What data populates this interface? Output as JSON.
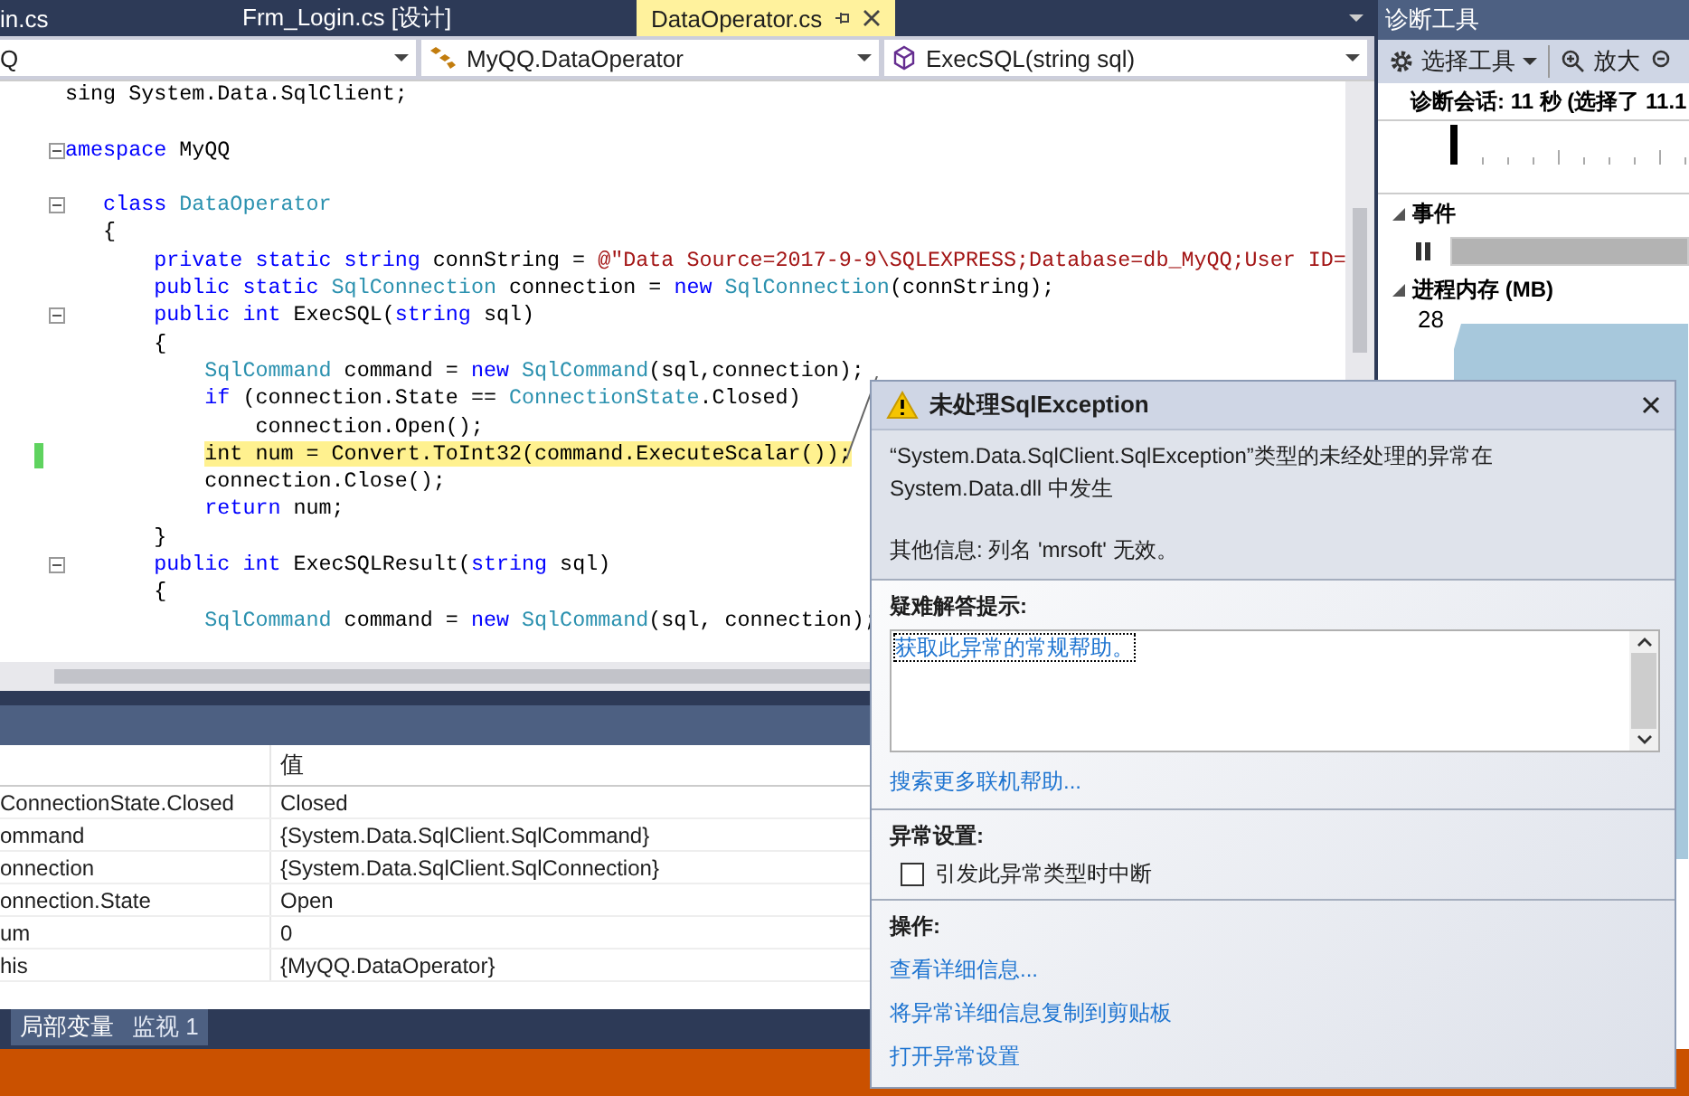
{
  "tabs": [
    {
      "label": "in.cs",
      "selected": false
    },
    {
      "label": "Frm_Login.cs [设计]",
      "selected": false
    },
    {
      "label": "DataOperator.cs",
      "selected": true
    }
  ],
  "nav": [
    {
      "kind": "project",
      "text": "Q"
    },
    {
      "kind": "class",
      "text": "MyQQ.DataOperator"
    },
    {
      "kind": "method",
      "text": "ExecSQL(string sql)"
    }
  ],
  "code": {
    "lines": [
      {
        "fold": false,
        "current": false,
        "segments": [
          {
            "kind": "plain",
            "text": "sing System.Data.SqlClient;"
          }
        ]
      },
      {
        "fold": false,
        "current": false
      },
      {
        "fold": true,
        "current": false,
        "segments": [
          {
            "kind": "kw",
            "text": "amespace"
          },
          {
            "kind": "plain",
            "text": " MyQQ"
          }
        ]
      },
      {
        "fold": false,
        "current": false
      },
      {
        "fold": true,
        "current": false,
        "segments": [
          {
            "kind": "kw",
            "text": "   class "
          },
          {
            "kind": "type",
            "text": "DataOperator"
          }
        ]
      },
      {
        "fold": false,
        "current": false,
        "segments": [
          {
            "kind": "plain",
            "text": "   {"
          }
        ]
      },
      {
        "fold": false,
        "current": false,
        "segments": [
          {
            "kind": "kw",
            "text": "       private static string"
          },
          {
            "kind": "plain",
            "text": " connString = "
          },
          {
            "kind": "str",
            "text": "@\"Data Source=2017-9-9\\SQLEXPRESS;Database=db_MyQQ;User ID="
          }
        ]
      },
      {
        "fold": false,
        "current": false,
        "segments": [
          {
            "kind": "kw",
            "text": "       public static "
          },
          {
            "kind": "type",
            "text": "SqlConnection"
          },
          {
            "kind": "plain",
            "text": " connection = "
          },
          {
            "kind": "kw",
            "text": "new "
          },
          {
            "kind": "type",
            "text": "SqlConnection"
          },
          {
            "kind": "plain",
            "text": "(connString);"
          }
        ]
      },
      {
        "fold": true,
        "current": false,
        "segments": [
          {
            "kind": "kw",
            "text": "       public int"
          },
          {
            "kind": "plain",
            "text": " ExecSQL("
          },
          {
            "kind": "kw",
            "text": "string"
          },
          {
            "kind": "plain",
            "text": " sql)"
          }
        ]
      },
      {
        "fold": false,
        "current": false,
        "segments": [
          {
            "kind": "plain",
            "text": "       {"
          }
        ]
      },
      {
        "fold": false,
        "current": false,
        "segments": [
          {
            "kind": "type",
            "text": "           SqlCommand"
          },
          {
            "kind": "plain",
            "text": " command = "
          },
          {
            "kind": "kw",
            "text": "new "
          },
          {
            "kind": "type",
            "text": "SqlCommand"
          },
          {
            "kind": "plain",
            "text": "(sql,connection);"
          }
        ]
      },
      {
        "fold": false,
        "current": false,
        "segments": [
          {
            "kind": "kw",
            "text": "           if"
          },
          {
            "kind": "plain",
            "text": " (connection.State == "
          },
          {
            "kind": "type",
            "text": "ConnectionState"
          },
          {
            "kind": "plain",
            "text": ".Closed)"
          }
        ]
      },
      {
        "fold": false,
        "current": false,
        "segments": [
          {
            "kind": "plain",
            "text": "               connection.Open();"
          }
        ]
      },
      {
        "fold": false,
        "current": true,
        "segments": [
          {
            "kind": "plain",
            "text": "           int num = Convert.ToInt32(command.ExecuteScalar());"
          }
        ]
      },
      {
        "fold": false,
        "current": false,
        "segments": [
          {
            "kind": "plain",
            "text": "           connection.Close();"
          }
        ]
      },
      {
        "fold": false,
        "current": false,
        "segments": [
          {
            "kind": "kw",
            "text": "           return"
          },
          {
            "kind": "plain",
            "text": " num;"
          }
        ]
      },
      {
        "fold": false,
        "current": false,
        "segments": [
          {
            "kind": "plain",
            "text": "       }"
          }
        ]
      },
      {
        "fold": true,
        "current": false,
        "segments": [
          {
            "kind": "kw",
            "text": "       public int"
          },
          {
            "kind": "plain",
            "text": " ExecSQLResult("
          },
          {
            "kind": "kw",
            "text": "string"
          },
          {
            "kind": "plain",
            "text": " sql)"
          }
        ]
      },
      {
        "fold": false,
        "current": false,
        "segments": [
          {
            "kind": "plain",
            "text": "       {"
          }
        ]
      },
      {
        "fold": false,
        "current": false,
        "segments": [
          {
            "kind": "type",
            "text": "           SqlCommand"
          },
          {
            "kind": "plain",
            "text": " command = "
          },
          {
            "kind": "kw",
            "text": "new "
          },
          {
            "kind": "type",
            "text": "SqlCommand"
          },
          {
            "kind": "plain",
            "text": "(sql, connection);"
          }
        ]
      }
    ]
  },
  "locals": {
    "value_heading": "值",
    "rows": [
      {
        "name": "ConnectionState.Closed",
        "value": "Closed"
      },
      {
        "name": "ommand",
        "value": "{System.Data.SqlClient.SqlCommand}"
      },
      {
        "name": "onnection",
        "value": "{System.Data.SqlClient.SqlConnection}"
      },
      {
        "name": "onnection.State",
        "value": "Open"
      },
      {
        "name": "um",
        "value": "0"
      },
      {
        "name": "his",
        "value": "{MyQQ.DataOperator}"
      }
    ],
    "tabs": [
      {
        "label": "局部变量",
        "selected": true
      },
      {
        "label": "监视 1",
        "selected": false
      }
    ]
  },
  "diagnostics": {
    "title": "诊断工具",
    "select_tools": "选择工具",
    "zoom_in": "放大",
    "session": "诊断会话: 11 秒 (选择了 11.1",
    "events_label": "事件",
    "memory_label": "进程内存 (MB)",
    "memory_max": "28"
  },
  "exception": {
    "title": "未处理SqlException",
    "message_lines": [
      "“System.Data.SqlClient.SqlException”类型的未经处理的异常在",
      "System.Data.dll 中发生"
    ],
    "details": "其他信息: 列名 'mrsoft' 无效。",
    "tips_heading": "疑难解答提示:",
    "tips": [
      {
        "text": "获取此异常的常规帮助。",
        "selected": true
      }
    ],
    "search_link": "搜索更多联机帮助...",
    "settings_heading": "异常设置:",
    "break_option": {
      "label": "引发此异常类型时中断",
      "checked": false
    },
    "actions_heading": "操作:",
    "actions": [
      "查看详细信息...",
      "将异常详细信息复制到剪贴板",
      "打开异常设置"
    ]
  }
}
